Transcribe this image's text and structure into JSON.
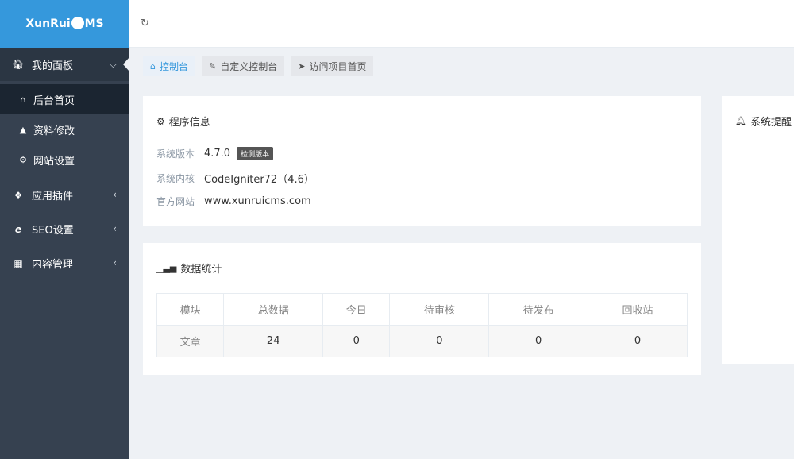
{
  "logo": {
    "text_a": "XunRui",
    "text_b": "MS"
  },
  "sidebar": {
    "items": [
      {
        "label": "我的面板",
        "icon": "home-icon",
        "open": true
      },
      {
        "label": "应用插件",
        "icon": "puzzle-icon"
      },
      {
        "label": "SEO设置",
        "icon": "ie-icon"
      },
      {
        "label": "内容管理",
        "icon": "grid-icon"
      }
    ],
    "submenu": [
      {
        "label": "后台首页",
        "icon": "home-icon",
        "active": true
      },
      {
        "label": "资料修改",
        "icon": "user-icon"
      },
      {
        "label": "网站设置",
        "icon": "gear-icon"
      }
    ]
  },
  "tabs": [
    {
      "label": "控制台",
      "icon": "home-icon",
      "active": true
    },
    {
      "label": "自定义控制台",
      "icon": "edit-icon"
    },
    {
      "label": "访问项目首页",
      "icon": "send-icon"
    }
  ],
  "info": {
    "title": "程序信息",
    "rows": [
      {
        "label": "系统版本",
        "value": "4.7.0",
        "badge": "检测版本"
      },
      {
        "label": "系统内核",
        "value": "CodeIgniter72（4.6）"
      },
      {
        "label": "官方网站",
        "value": "www.xunruicms.com"
      }
    ]
  },
  "stats": {
    "title": "数据统计",
    "headers": [
      "模块",
      "总数据",
      "今日",
      "待审核",
      "待发布",
      "回收站"
    ],
    "rows": [
      [
        "文章",
        "24",
        "0",
        "0",
        "0",
        "0"
      ]
    ]
  },
  "notice": {
    "title": "系统提醒"
  }
}
